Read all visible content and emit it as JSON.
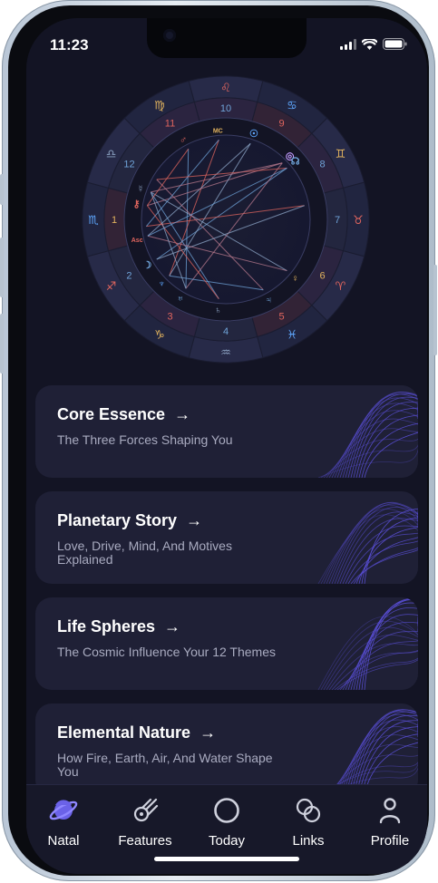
{
  "status_bar": {
    "time": "11:23"
  },
  "natal_chart": {
    "zodiac_signs": [
      "♌",
      "♋",
      "♊",
      "♉",
      "♈",
      "♓",
      "♒",
      "♑",
      "♐",
      "♏",
      "♎",
      "♍"
    ],
    "houses": [
      "10",
      "9",
      "8",
      "7",
      "6",
      "5",
      "4",
      "3",
      "2",
      "1",
      "12",
      "11"
    ],
    "planet_glyphs": [
      "♂",
      "MC",
      "☉",
      "◎",
      "☊",
      "♀",
      "♃",
      "♄",
      "♅",
      "♆",
      "☽",
      "Asc",
      "⚷",
      "☿"
    ]
  },
  "cards": [
    {
      "title": "Core Essence",
      "arrow": "→",
      "subtitle": "The Three Forces Shaping You"
    },
    {
      "title": "Planetary Story",
      "arrow": "→",
      "subtitle": "Love, Drive, Mind, And Motives Explained"
    },
    {
      "title": "Life Spheres",
      "arrow": "→",
      "subtitle": "The Cosmic Influence Your 12 Themes"
    },
    {
      "title": "Elemental Nature",
      "arrow": "→",
      "subtitle": "How Fire, Earth, Air, And Water Shape You"
    }
  ],
  "tabs": [
    {
      "label": "Natal",
      "icon": "planet-icon",
      "active": true
    },
    {
      "label": "Features",
      "icon": "comet-icon"
    },
    {
      "label": "Today",
      "icon": "circle-icon"
    },
    {
      "label": "Links",
      "icon": "links-icon"
    },
    {
      "label": "Profile",
      "icon": "profile-icon"
    }
  ],
  "colors": {
    "background": "#131424",
    "card": "#1f2036",
    "accent": "#6b62e8",
    "fire": "#e0655e",
    "water": "#5fa8ff",
    "gold": "#e2b35e"
  }
}
